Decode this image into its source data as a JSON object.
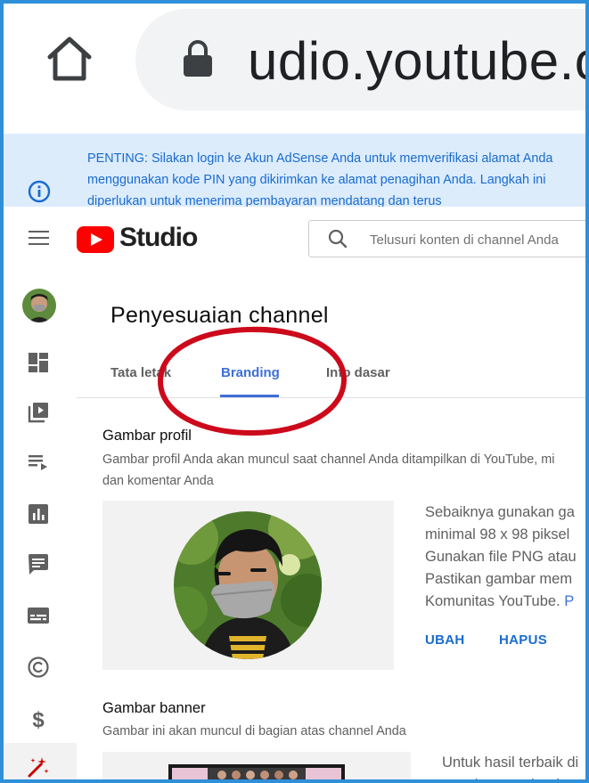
{
  "browser": {
    "url": "udio.youtube.c",
    "home_icon": "home-icon",
    "lock_icon": "lock-icon"
  },
  "notice": {
    "icon": "info-icon",
    "text": "PENTING: Silakan login ke Akun AdSense Anda untuk memverifikasi alamat Anda menggunakan kode PIN yang dikirimkan ke alamat penagihan Anda. Langkah ini diperlukan untuk menerima pembayaran mendatang dan terus"
  },
  "header": {
    "logo_text": "Studio",
    "search_placeholder": "Telusuri konten di channel Anda"
  },
  "sidebar": {
    "items": [
      {
        "icon": "avatar"
      },
      {
        "icon": "dashboard-icon"
      },
      {
        "icon": "content-icon"
      },
      {
        "icon": "playlists-icon"
      },
      {
        "icon": "analytics-icon"
      },
      {
        "icon": "comments-icon"
      },
      {
        "icon": "subtitles-icon"
      },
      {
        "icon": "copyright-icon"
      },
      {
        "icon": "monetization-icon"
      },
      {
        "icon": "customization-icon",
        "active": true
      }
    ]
  },
  "page": {
    "title": "Penyesuaian channel",
    "tabs": [
      {
        "label": "Tata letak"
      },
      {
        "label": "Branding",
        "active": true
      },
      {
        "label": "Info dasar"
      }
    ]
  },
  "profile_picture": {
    "title": "Gambar profil",
    "description": "Gambar profil Anda akan muncul saat channel Anda ditampilkan di YouTube, misalnya di samping video Anda dan komentar Anda",
    "desc_line1": "Gambar profil Anda akan muncul saat channel Anda ditampilkan di YouTube, mi",
    "desc_line2": "dan komentar Anda",
    "guidance_lines": [
      "Sebaiknya gunakan ga",
      "minimal 98 x 98 piksel",
      "Gunakan file PNG atau",
      "Pastikan gambar mem",
      "Komunitas YouTube. "
    ],
    "guidance_link": "P",
    "change_label": "UBAH",
    "remove_label": "HAPUS"
  },
  "banner": {
    "title": "Gambar banner",
    "description": "Gambar ini akan muncul di bagian atas channel Anda",
    "guidance_lines": [
      "Untuk hasil terbaik di",
      "gunakan gambar bera"
    ]
  },
  "colors": {
    "accent": "#3e6fd8",
    "notice_bg": "#dcecfb",
    "notice_text": "#1a6bd1",
    "youtube_red": "#ff0000",
    "annotation": "#cc0a1b",
    "frame_border": "#2f8fd8"
  }
}
